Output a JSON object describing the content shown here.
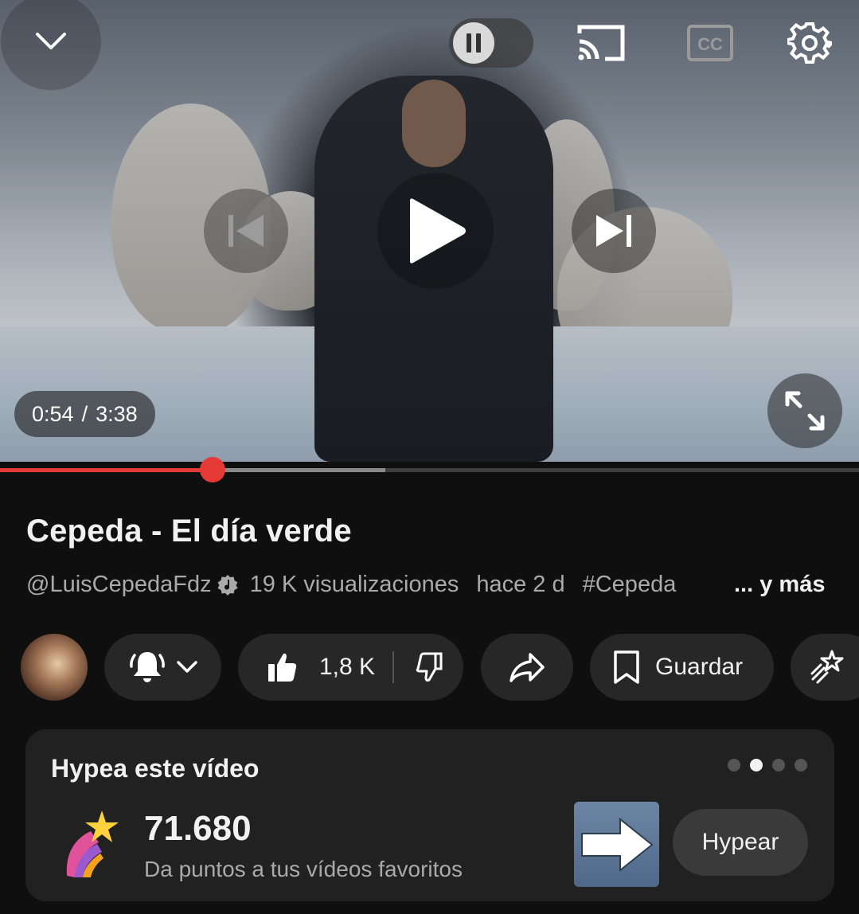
{
  "player": {
    "current_time": "0:54",
    "time_separator": "/",
    "duration": "3:38",
    "progress_fraction": 0.247,
    "buffered_fraction": 0.449
  },
  "video": {
    "title": "Cepeda - El día verde",
    "channel": "@LuisCepedaFdz",
    "views": "19 K visualizaciones",
    "age": "hace 2 d",
    "hashtag": "#Cepeda",
    "more": "... y más"
  },
  "actions": {
    "like_count": "1,8 K",
    "save_label": "Guardar"
  },
  "hype": {
    "title": "Hypea este vídeo",
    "count": "71.680",
    "subtitle": "Da puntos a tus vídeos favoritos",
    "button": "Hypear",
    "carousel_dots": 4,
    "active_dot": 2
  },
  "colors": {
    "accent": "#e53935",
    "background": "#0f0f0f",
    "chip": "#272727"
  },
  "icons": [
    "chevron-down-icon",
    "pause-icon",
    "cast-icon",
    "cc-icon",
    "gear-icon",
    "skip-previous-icon",
    "play-icon",
    "skip-next-icon",
    "fullscreen-icon",
    "verified-music-icon",
    "bell-ringing-icon",
    "chevron-down-icon",
    "thumbs-up-icon",
    "thumbs-down-icon",
    "share-icon",
    "bookmark-icon",
    "clip-icon",
    "shooting-star-icon",
    "arrow-right-icon"
  ]
}
